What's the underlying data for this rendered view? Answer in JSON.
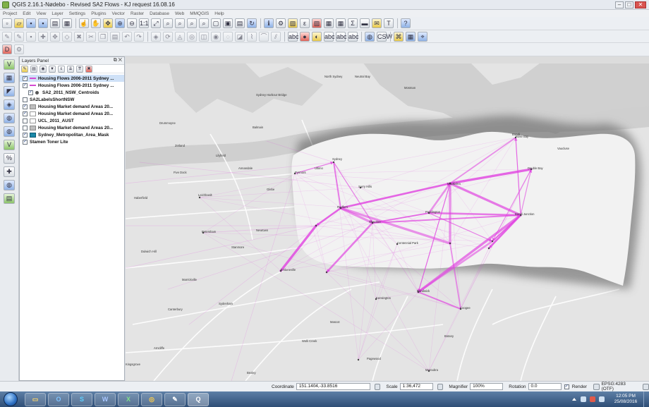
{
  "window": {
    "title": "QGIS 2.16.1-Nødebo - Revised SA2 Flows - KJ request 16.08.16",
    "minimize": "–",
    "maximize": "□",
    "close": "✕"
  },
  "menu": [
    "Project",
    "Edit",
    "View",
    "Layer",
    "Settings",
    "Plugins",
    "Vector",
    "Raster",
    "Database",
    "Web",
    "MMQGIS",
    "Help"
  ],
  "toolbar": {
    "csw_label": "CSW",
    "abc_label": "abc"
  },
  "layers_panel": {
    "title": "Layers Panel",
    "float_btn": "⧉",
    "close_btn": "✕",
    "layers": [
      {
        "label": "Housing Flows 2006-2011 Sydney ...",
        "checked": true,
        "symbol": "line",
        "child": false,
        "selected": true
      },
      {
        "label": "Housing Flows 2006-2011 Sydney ...",
        "checked": true,
        "symbol": "line",
        "child": false,
        "selected": false
      },
      {
        "label": "SA2_2011_NSW_Centroids",
        "checked": true,
        "symbol": "dot",
        "child": true,
        "selected": false
      },
      {
        "label": "SA2LabelsShortNSW",
        "checked": false,
        "symbol": "none",
        "child": false,
        "selected": false
      },
      {
        "label": "Housing Market demand Areas 20...",
        "checked": true,
        "symbol": "fill-gray",
        "child": false,
        "selected": false
      },
      {
        "label": "Housing Market demand Areas 20...",
        "checked": true,
        "symbol": "fill-white",
        "child": false,
        "selected": false
      },
      {
        "label": "UCL_2011_AUST",
        "checked": false,
        "symbol": "fill-white",
        "child": false,
        "selected": false
      },
      {
        "label": "Housing Market demand Areas 20...",
        "checked": false,
        "symbol": "fill-gray",
        "child": false,
        "selected": false
      },
      {
        "label": "Sydney_Metropolitan_Area_Mask",
        "checked": true,
        "symbol": "fill-teal",
        "child": false,
        "selected": false
      },
      {
        "label": "Stamen Toner Lite",
        "checked": true,
        "symbol": "none",
        "child": false,
        "selected": false
      }
    ]
  },
  "map": {
    "flow_color": "#e040e0",
    "labels": [
      {
        "text": "Sydney Harbour Bridge"
      },
      {
        "text": "Zetland"
      },
      {
        "text": "Sydney"
      },
      {
        "text": "Pyrmont"
      },
      {
        "text": "Glebe"
      },
      {
        "text": "Surry Hills"
      },
      {
        "text": "Paddington"
      },
      {
        "text": "Redfern"
      },
      {
        "text": "Waterloo"
      },
      {
        "text": "Erskineville"
      },
      {
        "text": "Marrickville"
      },
      {
        "text": "Newtown"
      },
      {
        "text": "Leichhardt"
      },
      {
        "text": "Balmain"
      },
      {
        "text": "Drummoyne"
      },
      {
        "text": "Haberfield"
      },
      {
        "text": "Petersham"
      },
      {
        "text": "Dulwich Hill"
      },
      {
        "text": "Sydenham"
      },
      {
        "text": "Arncliffe"
      },
      {
        "text": "Kingsgrove"
      },
      {
        "text": "Bondi"
      },
      {
        "text": "Bondi Junction"
      },
      {
        "text": "Rose Bay"
      },
      {
        "text": "Double Bay"
      },
      {
        "text": "Randwick"
      },
      {
        "text": "Coogee"
      },
      {
        "text": "Kensington"
      },
      {
        "text": "Maroubra"
      },
      {
        "text": "Pagewood"
      },
      {
        "text": "Centennial Park"
      },
      {
        "text": "Vaucluse"
      },
      {
        "text": "Neutral Bay"
      },
      {
        "text": "North Sydney"
      },
      {
        "text": "Mosman"
      },
      {
        "text": "Woollahra"
      },
      {
        "text": "Mascot"
      },
      {
        "text": "Ultimo"
      },
      {
        "text": "Annandale"
      },
      {
        "text": "Canterbury"
      },
      {
        "text": "Bexley"
      },
      {
        "text": "Botany"
      },
      {
        "text": "Wolli Creek"
      },
      {
        "text": "Stanmore"
      },
      {
        "text": "Lilyfield"
      },
      {
        "text": "Five Dock"
      }
    ]
  },
  "statusbar": {
    "coordinate_label": "Coordinate",
    "coordinate_value": "151.1404,-33.8516",
    "scale_label": "Scale",
    "scale_value": "1:36,472",
    "magnifier_label": "Magnifier",
    "magnifier_value": "100%",
    "rotation_label": "Rotation",
    "rotation_value": "0.0",
    "render_label": "Render",
    "crs_label": "EPSG:4283 (OTF)"
  },
  "taskbar": {
    "apps": [
      "folder",
      "outlook",
      "skype",
      "word",
      "excel",
      "chrome",
      "paint",
      "qgis"
    ],
    "app_glyphs": [
      "▭",
      "O",
      "S",
      "W",
      "X",
      "◎",
      "✎",
      "Q"
    ],
    "time": "12:05 PM",
    "date": "25/08/2016"
  }
}
